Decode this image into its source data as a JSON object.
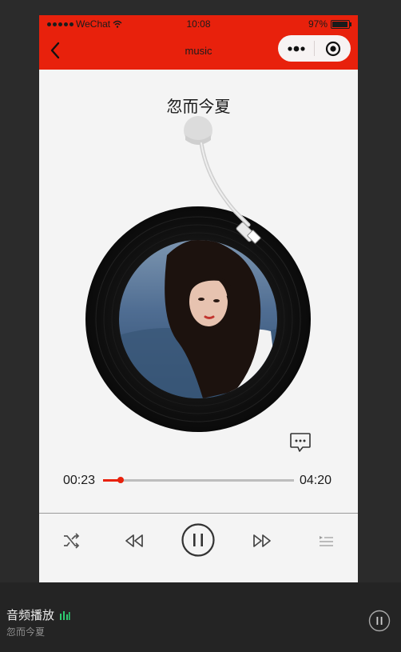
{
  "status_bar": {
    "carrier": "WeChat",
    "time": "10:08",
    "battery": "97%"
  },
  "nav": {
    "title": "music",
    "back_icon": "chevron-left-icon",
    "more_icon": "more-dots-icon",
    "close_icon": "target-icon",
    "bar_color": "#e8210c"
  },
  "player": {
    "song_title": "忽而今夏",
    "current_time": "00:23",
    "total_time": "04:20",
    "progress": 0.09,
    "accent_color": "#e8210c",
    "controls": [
      "shuffle-icon",
      "previous-icon",
      "pause-icon",
      "next-icon",
      "playlist-icon"
    ]
  },
  "mini_player": {
    "title": "音频播放",
    "subtitle": "忽而今夏",
    "equalizer_color": "#2ecc71"
  }
}
